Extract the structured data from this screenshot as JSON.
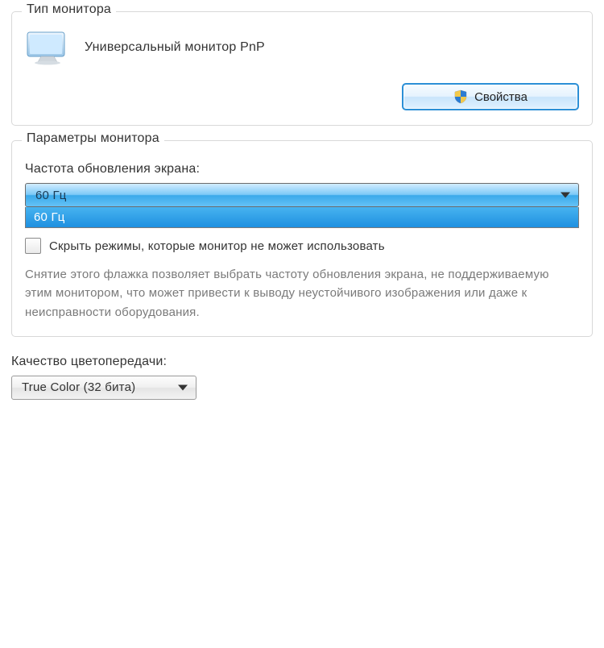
{
  "monitorType": {
    "legend": "Тип монитора",
    "name": "Универсальный монитор PnP",
    "propertiesBtn": "Свойства"
  },
  "monitorSettings": {
    "legend": "Параметры монитора",
    "refreshLabel": "Частота обновления экрана:",
    "refreshSelected": "60 Гц",
    "refreshOptions": [
      "60 Гц"
    ],
    "hideModesLabel": "Скрыть режимы, которые монитор не может использовать",
    "hideModesChecked": false,
    "hint": "Снятие этого флажка позволяет выбрать частоту обновления экрана, не поддерживаемую этим монитором, что может привести к выводу неустойчивого изображения или даже к неисправности оборудования."
  },
  "colorQuality": {
    "label": "Качество цветопередачи:",
    "selected": "True Color (32 бита)"
  }
}
